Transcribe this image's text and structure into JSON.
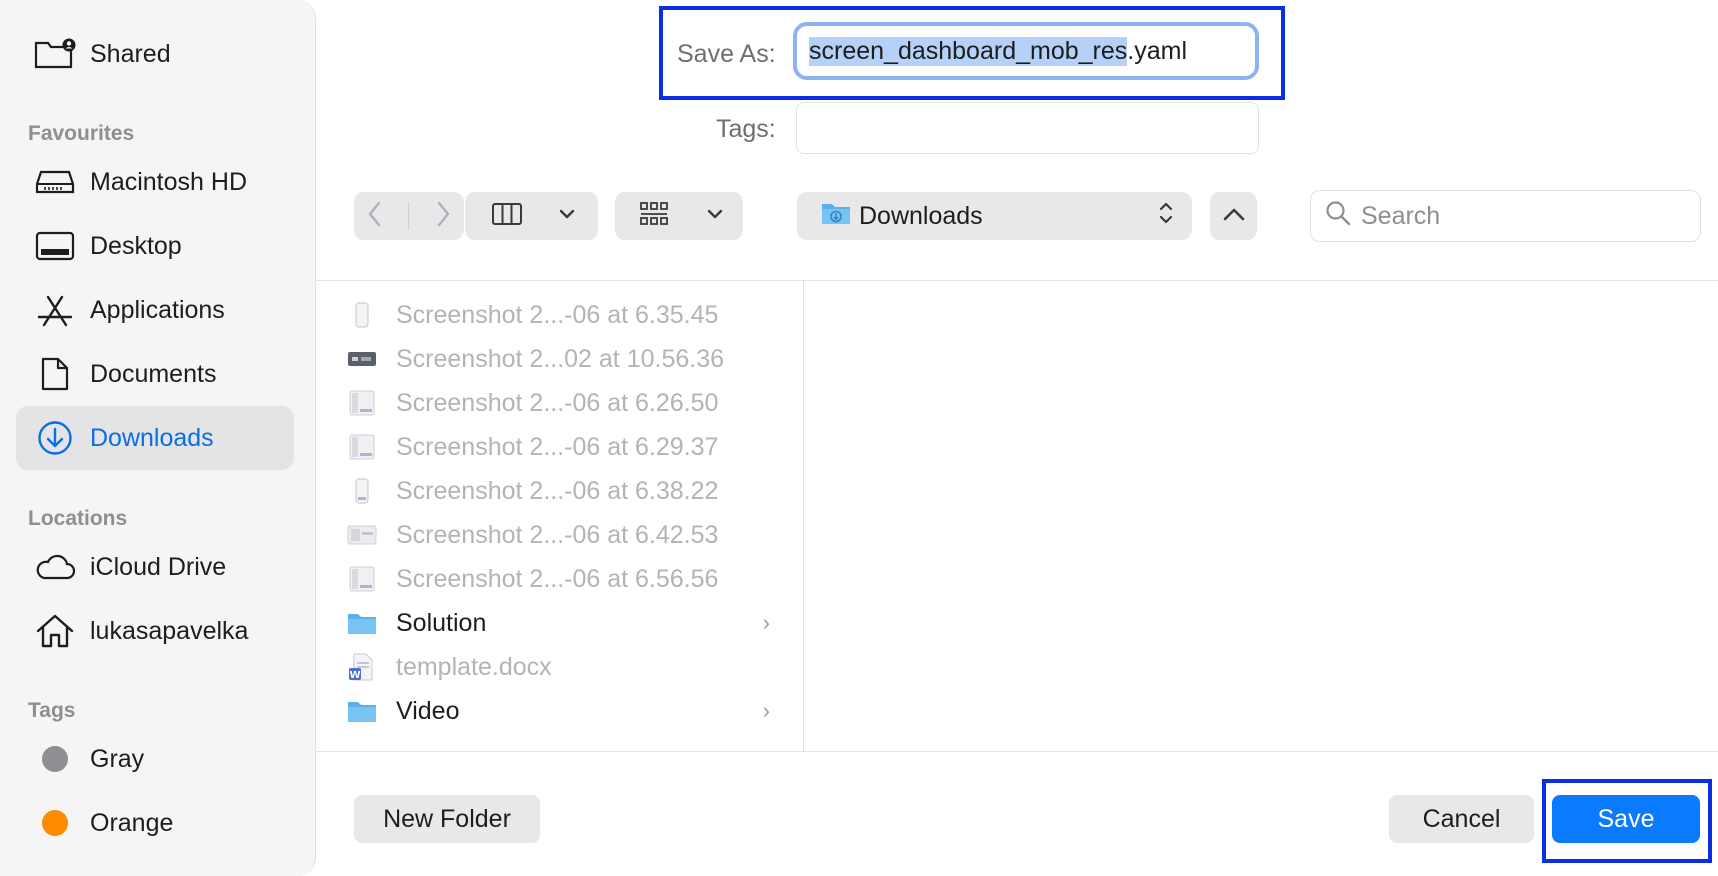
{
  "sidebar": {
    "shared_label": "Shared",
    "favourites_title": "Favourites",
    "favourites": [
      {
        "label": "Macintosh HD",
        "icon": "hard-drive-icon"
      },
      {
        "label": "Desktop",
        "icon": "desktop-icon"
      },
      {
        "label": "Applications",
        "icon": "applications-icon"
      },
      {
        "label": "Documents",
        "icon": "document-icon"
      },
      {
        "label": "Downloads",
        "icon": "download-icon",
        "active": true
      }
    ],
    "locations_title": "Locations",
    "locations": [
      {
        "label": "iCloud Drive",
        "icon": "cloud-icon"
      },
      {
        "label": "lukasapavelka",
        "icon": "home-icon"
      }
    ],
    "tags_title": "Tags",
    "tags": [
      {
        "label": "Gray",
        "color": "#8e8e93"
      },
      {
        "label": "Orange",
        "color": "#ff8a00"
      }
    ]
  },
  "header": {
    "save_as_label": "Save As:",
    "filename_selected": "screen_dashboard_mob_res",
    "filename_ext": ".yaml",
    "tags_label": "Tags:"
  },
  "toolbar": {
    "location": "Downloads",
    "search_placeholder": "Search"
  },
  "files": [
    {
      "name": "Screenshot 2...-06 at 6.35.45",
      "type": "image"
    },
    {
      "name": "Screenshot 2...02 at 10.56.36",
      "type": "image"
    },
    {
      "name": "Screenshot 2...-06 at 6.26.50",
      "type": "image"
    },
    {
      "name": "Screenshot 2...-06 at 6.29.37",
      "type": "image"
    },
    {
      "name": "Screenshot 2...-06 at 6.38.22",
      "type": "image"
    },
    {
      "name": "Screenshot 2...-06 at 6.42.53",
      "type": "image"
    },
    {
      "name": "Screenshot 2...-06 at 6.56.56",
      "type": "image"
    },
    {
      "name": "Solution",
      "type": "folder"
    },
    {
      "name": "template.docx",
      "type": "docx"
    },
    {
      "name": "Video",
      "type": "folder"
    }
  ],
  "footer": {
    "new_folder_label": "New Folder",
    "cancel_label": "Cancel",
    "save_label": "Save"
  },
  "colors": {
    "accent": "#0a7aff",
    "highlight_box": "#0a2fe0",
    "selection": "#b5d1f7"
  }
}
